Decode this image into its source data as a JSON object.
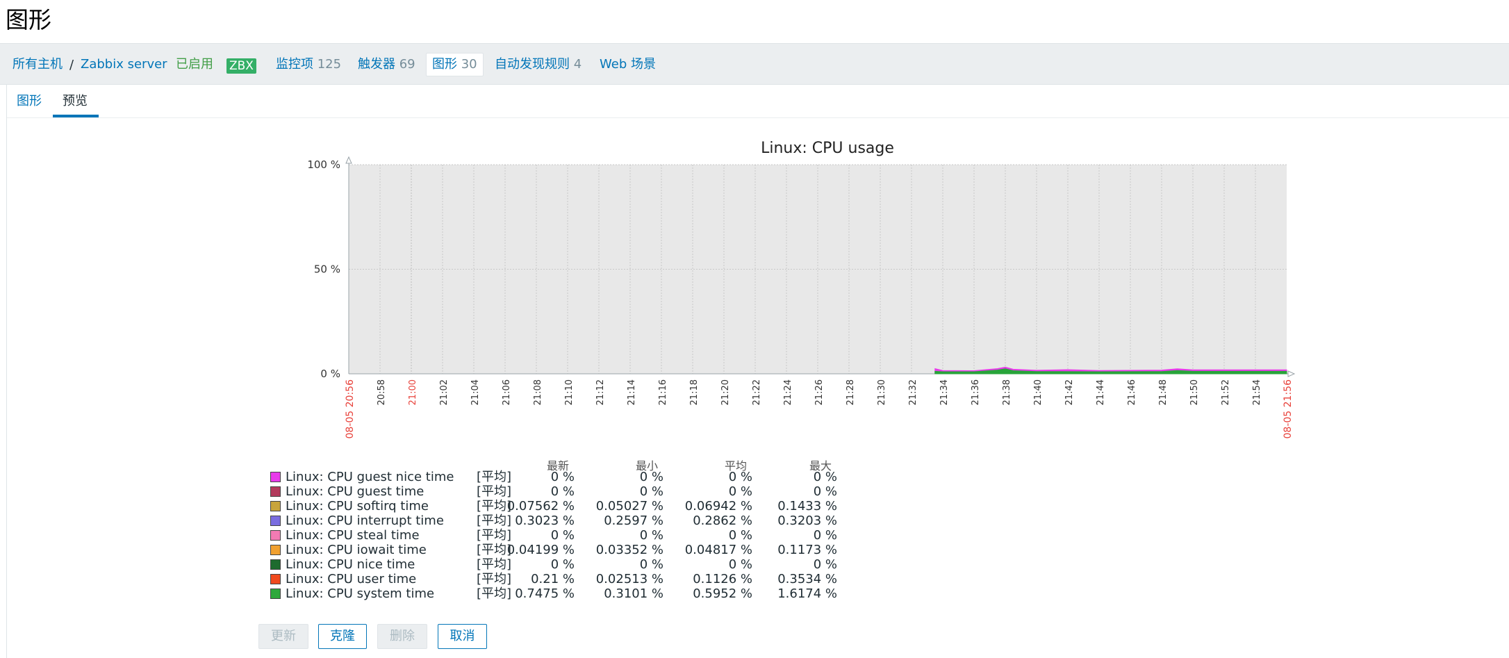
{
  "page": {
    "title": "图形"
  },
  "header": {
    "breadcrumb_all_hosts": "所有主机",
    "breadcrumb_sep": "/",
    "host_name": "Zabbix server",
    "status": "已启用",
    "zbx_badge": "ZBX",
    "items_label": "监控项",
    "items_count": "125",
    "triggers_label": "触发器",
    "triggers_count": "69",
    "graphs_label": "图形",
    "graphs_count": "30",
    "discovery_label": "自动发现规则",
    "discovery_count": "4",
    "web_label": "Web 场景",
    "colors": {
      "link": "#0275b8",
      "status": "#429e47",
      "badge_bg": "#34af67"
    }
  },
  "tabs": {
    "graph": "图形",
    "preview": "预览",
    "active": "preview"
  },
  "chart_data": {
    "type": "area",
    "title": "Linux: CPU usage",
    "y_ticks": [
      "100 %",
      "50 %",
      "0 %"
    ],
    "ylim": [
      0,
      100
    ],
    "y_unit": "%",
    "x_ticks": [
      "20:58",
      "21:00",
      "21:02",
      "21:04",
      "21:06",
      "21:08",
      "21:10",
      "21:12",
      "21:14",
      "21:16",
      "21:18",
      "21:20",
      "21:22",
      "21:24",
      "21:26",
      "21:28",
      "21:30",
      "21:32",
      "21:34",
      "21:36",
      "21:38",
      "21:40",
      "21:42",
      "21:44",
      "21:46",
      "21:48",
      "21:50",
      "21:52",
      "21:54"
    ],
    "x_highlight_ticks": [
      "21:00"
    ],
    "x_start_label": "08-05 20:56",
    "x_end_label": "08-05 21:56",
    "x_range_minutes": [
      0,
      60
    ],
    "grid": true,
    "plot_background": "#e8e8e8",
    "series_stack": [
      {
        "color": "#28a43a",
        "points": [
          [
            37.5,
            1.2
          ],
          [
            38,
            1.0
          ],
          [
            40,
            1.0
          ],
          [
            41.5,
            1.8
          ],
          [
            42,
            2.4
          ],
          [
            42.5,
            1.5
          ],
          [
            44,
            1.1
          ],
          [
            48,
            1.0
          ],
          [
            52,
            1.1
          ],
          [
            53,
            1.6
          ],
          [
            54,
            1.2
          ],
          [
            60,
            1.2
          ]
        ]
      },
      {
        "color": "#e83aea",
        "points": [
          [
            37.5,
            2.5
          ],
          [
            38,
            1.6
          ],
          [
            40,
            1.5
          ],
          [
            41.5,
            2.5
          ],
          [
            42,
            3.2
          ],
          [
            42.5,
            2.2
          ],
          [
            44,
            1.7
          ],
          [
            46,
            2.0
          ],
          [
            48,
            1.6
          ],
          [
            52,
            1.8
          ],
          [
            53,
            2.4
          ],
          [
            54,
            1.9
          ],
          [
            60,
            1.9
          ]
        ]
      }
    ]
  },
  "legend": {
    "headers": [
      "最新",
      "最小",
      "平均",
      "最大"
    ],
    "rows": [
      {
        "name": "Linux: CPU guest nice time",
        "type": "[平均]",
        "color": "#e83aea",
        "last": "0 %",
        "min": "0 %",
        "avg": "0 %",
        "max": "0 %"
      },
      {
        "name": "Linux: CPU guest time",
        "type": "[平均]",
        "color": "#b23a5c",
        "last": "0 %",
        "min": "0 %",
        "avg": "0 %",
        "max": "0 %"
      },
      {
        "name": "Linux: CPU softirq time",
        "type": "[平均]",
        "color": "#c8a43c",
        "last": "0.07562 %",
        "min": "0.05027 %",
        "avg": "0.06942 %",
        "max": "0.1433 %"
      },
      {
        "name": "Linux: CPU interrupt time",
        "type": "[平均]",
        "color": "#7a6de0",
        "last": "0.3023 %",
        "min": "0.2597 %",
        "avg": "0.2862 %",
        "max": "0.3203 %"
      },
      {
        "name": "Linux: CPU steal time",
        "type": "[平均]",
        "color": "#f27bb4",
        "last": "0 %",
        "min": "0 %",
        "avg": "0 %",
        "max": "0 %"
      },
      {
        "name": "Linux: CPU iowait time",
        "type": "[平均]",
        "color": "#f0a030",
        "last": "0.04199 %",
        "min": "0.03352 %",
        "avg": "0.04817 %",
        "max": "0.1173 %"
      },
      {
        "name": "Linux: CPU nice time",
        "type": "[平均]",
        "color": "#1e6b2e",
        "last": "0 %",
        "min": "0 %",
        "avg": "0 %",
        "max": "0 %"
      },
      {
        "name": "Linux: CPU user time",
        "type": "[平均]",
        "color": "#f04a1e",
        "last": "0.21 %",
        "min": "0.02513 %",
        "avg": "0.1126 %",
        "max": "0.3534 %"
      },
      {
        "name": "Linux: CPU system time",
        "type": "[平均]",
        "color": "#2fa83c",
        "last": "0.7475 %",
        "min": "0.3101 %",
        "avg": "0.5952 %",
        "max": "1.6174 %"
      }
    ]
  },
  "buttons": {
    "update": "更新",
    "clone": "克隆",
    "delete": "删除",
    "cancel": "取消"
  }
}
